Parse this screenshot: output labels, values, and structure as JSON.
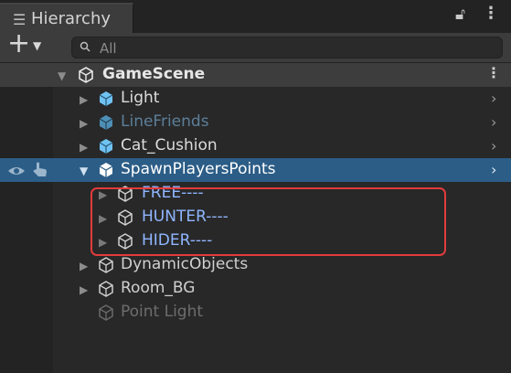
{
  "panel": {
    "title": "Hierarchy",
    "tab_icon": "hamburger-list-icon",
    "lock_icon": "lock-icon",
    "menu_icon": "kebab-menu-icon"
  },
  "toolbar": {
    "add_icon": "plus-icon",
    "dropdown_icon": "caret-down-icon",
    "search_placeholder": "All",
    "search_icon": "search-icon"
  },
  "scene": {
    "name": "GameScene",
    "icon": "unity-scene-icon",
    "menu_icon": "kebab-menu-icon"
  },
  "items": [
    {
      "label": "Light",
      "icon": "prefab-cube-icon",
      "color": "#dcdcdc",
      "icon_color": "#6fc2f2",
      "selected": false
    },
    {
      "label": "LineFriends",
      "icon": "prefab-cube-icon",
      "color": "#5c7f99",
      "icon_color": "#4e8fb6",
      "selected": false
    },
    {
      "label": "Cat_Cushion",
      "icon": "prefab-cube-icon",
      "color": "#dcdcdc",
      "icon_color": "#6fc2f2",
      "selected": false
    },
    {
      "label": "SpawnPlayersPoints",
      "icon": "prefab-cube-icon",
      "color": "#ffffff",
      "icon_color": "#ffffff",
      "selected": true
    },
    {
      "label": "FREE----",
      "icon": "gameobject-cube-icon",
      "color": "#8fb6ff"
    },
    {
      "label": "HUNTER----",
      "icon": "gameobject-cube-icon",
      "color": "#8fb6ff"
    },
    {
      "label": "HIDER----",
      "icon": "gameobject-cube-icon",
      "color": "#8fb6ff"
    },
    {
      "label": "DynamicObjects",
      "icon": "gameobject-cube-icon",
      "color": "#d0d0d0"
    },
    {
      "label": "Room_BG",
      "icon": "gameobject-cube-icon",
      "color": "#d0d0d0"
    },
    {
      "label": "Point Light",
      "icon": "gameobject-cube-icon",
      "color": "#6d6d6d"
    }
  ],
  "row_icons": {
    "visibility_icon": "eye-icon",
    "pick_icon": "pointing-hand-icon",
    "expand_icon": "chevron-right-icon"
  },
  "colors": {
    "panel_bg": "#282828",
    "selection": "#2c5d87",
    "highlight_border": "#e23b3b"
  }
}
